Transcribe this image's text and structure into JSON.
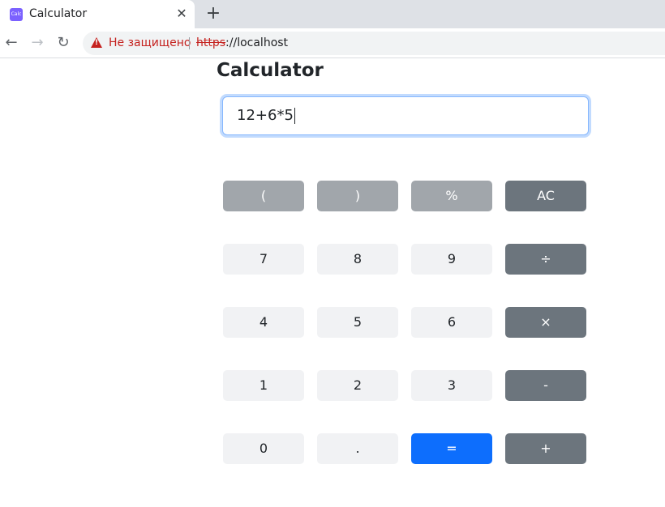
{
  "browser": {
    "tab_title": "Calculator",
    "favicon_text": "Calc",
    "close_glyph": "✕",
    "newtab_glyph": "+",
    "back_glyph": "←",
    "forward_glyph": "→",
    "reload_glyph": "↻",
    "security_text": "Не защищено",
    "url_scheme": "https",
    "url_rest": "://localhost"
  },
  "page": {
    "title": "Calculator",
    "display_value": "12+6*5"
  },
  "keys": {
    "open_paren": "(",
    "close_paren": ")",
    "percent": "%",
    "clear": "AC",
    "seven": "7",
    "eight": "8",
    "nine": "9",
    "divide": "÷",
    "four": "4",
    "five": "5",
    "six": "6",
    "multiply": "×",
    "one": "1",
    "two": "2",
    "three": "3",
    "minus": "-",
    "zero": "0",
    "dot": ".",
    "equals": "=",
    "plus": "+"
  },
  "colors": {
    "primary": "#0d6efd",
    "operator": "#6c757d",
    "muted": "#a1a6ab",
    "digit": "#f1f2f4",
    "warning": "#c5221f"
  }
}
